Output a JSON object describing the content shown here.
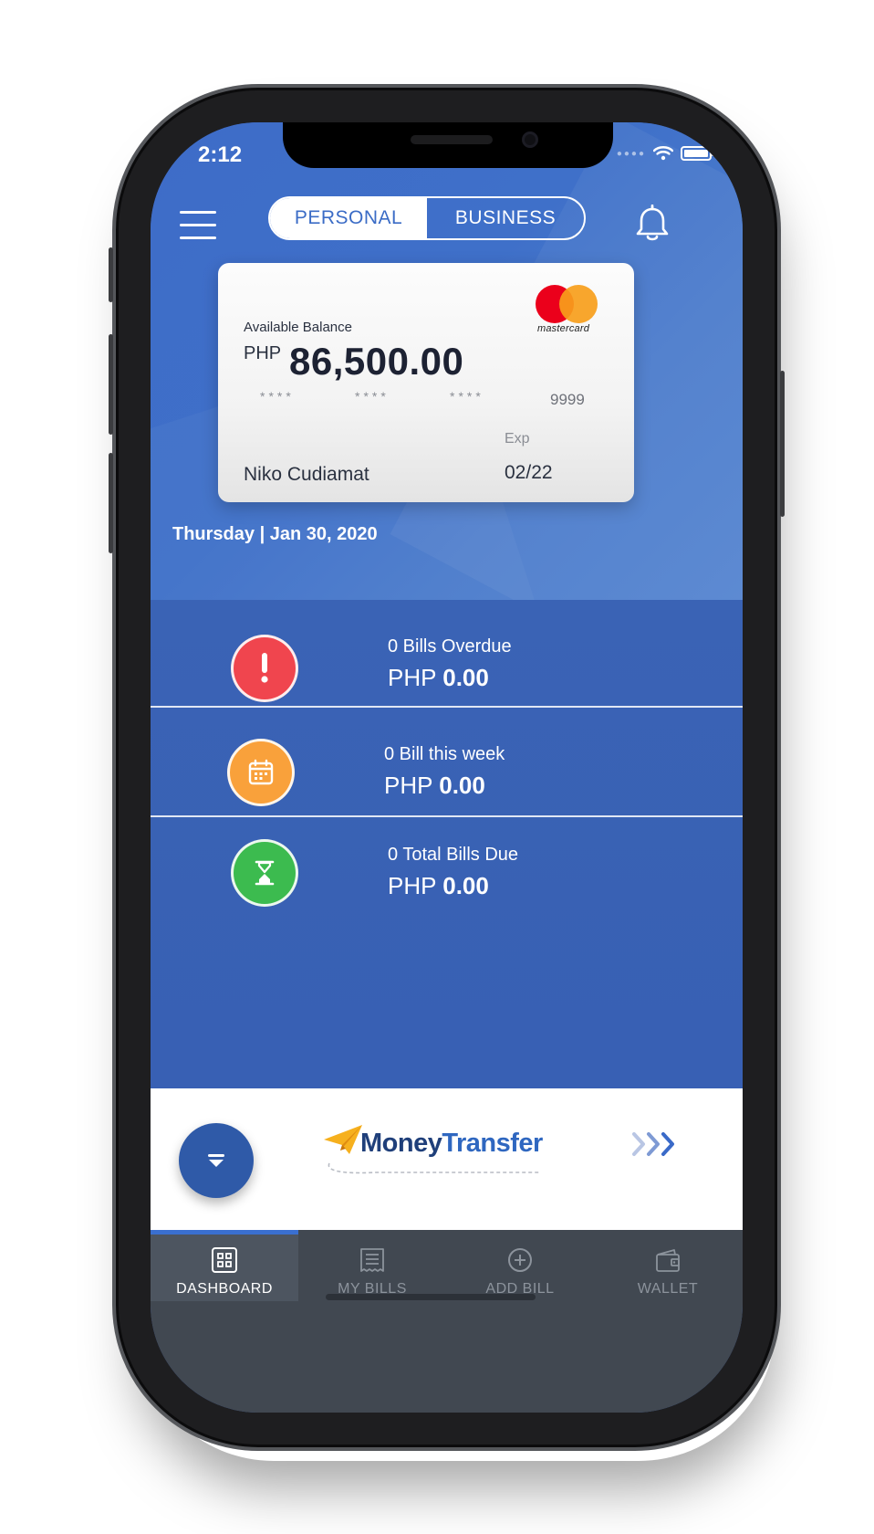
{
  "status_bar": {
    "time": "2:12"
  },
  "header": {
    "tabs": [
      {
        "label": "PERSONAL",
        "active": true
      },
      {
        "label": "BUSINESS",
        "active": false
      }
    ],
    "menu_icon": "hamburger-icon",
    "notification_icon": "bell-icon"
  },
  "card": {
    "available_label": "Available Balance",
    "currency": "PHP",
    "balance": "86,500.00",
    "masked_groups": [
      "****",
      "****",
      "****"
    ],
    "last4": "9999",
    "exp_label": "Exp",
    "exp": "02/22",
    "holder": "Niko Cudiamat",
    "brand": "mastercard"
  },
  "date": "Thursday | Jan 30, 2020",
  "bills": [
    {
      "title": "0 Bills Overdue",
      "currency": "PHP",
      "amount": "0.00",
      "icon": "exclamation-icon",
      "color": "#f0454e"
    },
    {
      "title": "0 Bill this week",
      "currency": "PHP",
      "amount": "0.00",
      "icon": "calendar-icon",
      "color": "#f9a13b"
    },
    {
      "title": "0 Total Bills Due",
      "currency": "PHP",
      "amount": "0.00",
      "icon": "hourglass-icon",
      "color": "#3cbb4f"
    }
  ],
  "banner": {
    "money": "Money",
    "transfer": "Transfer"
  },
  "tabbar": [
    {
      "label": "DASHBOARD",
      "icon": "dashboard-icon",
      "active": true
    },
    {
      "label": "MY BILLS",
      "icon": "bills-icon",
      "active": false
    },
    {
      "label": "ADD BILL",
      "icon": "add-icon",
      "active": false
    },
    {
      "label": "WALLET",
      "icon": "wallet-icon",
      "active": false
    }
  ],
  "colors": {
    "primary": "#3a63b5",
    "accent": "#3a6fd0",
    "tabbar": "#414851"
  }
}
